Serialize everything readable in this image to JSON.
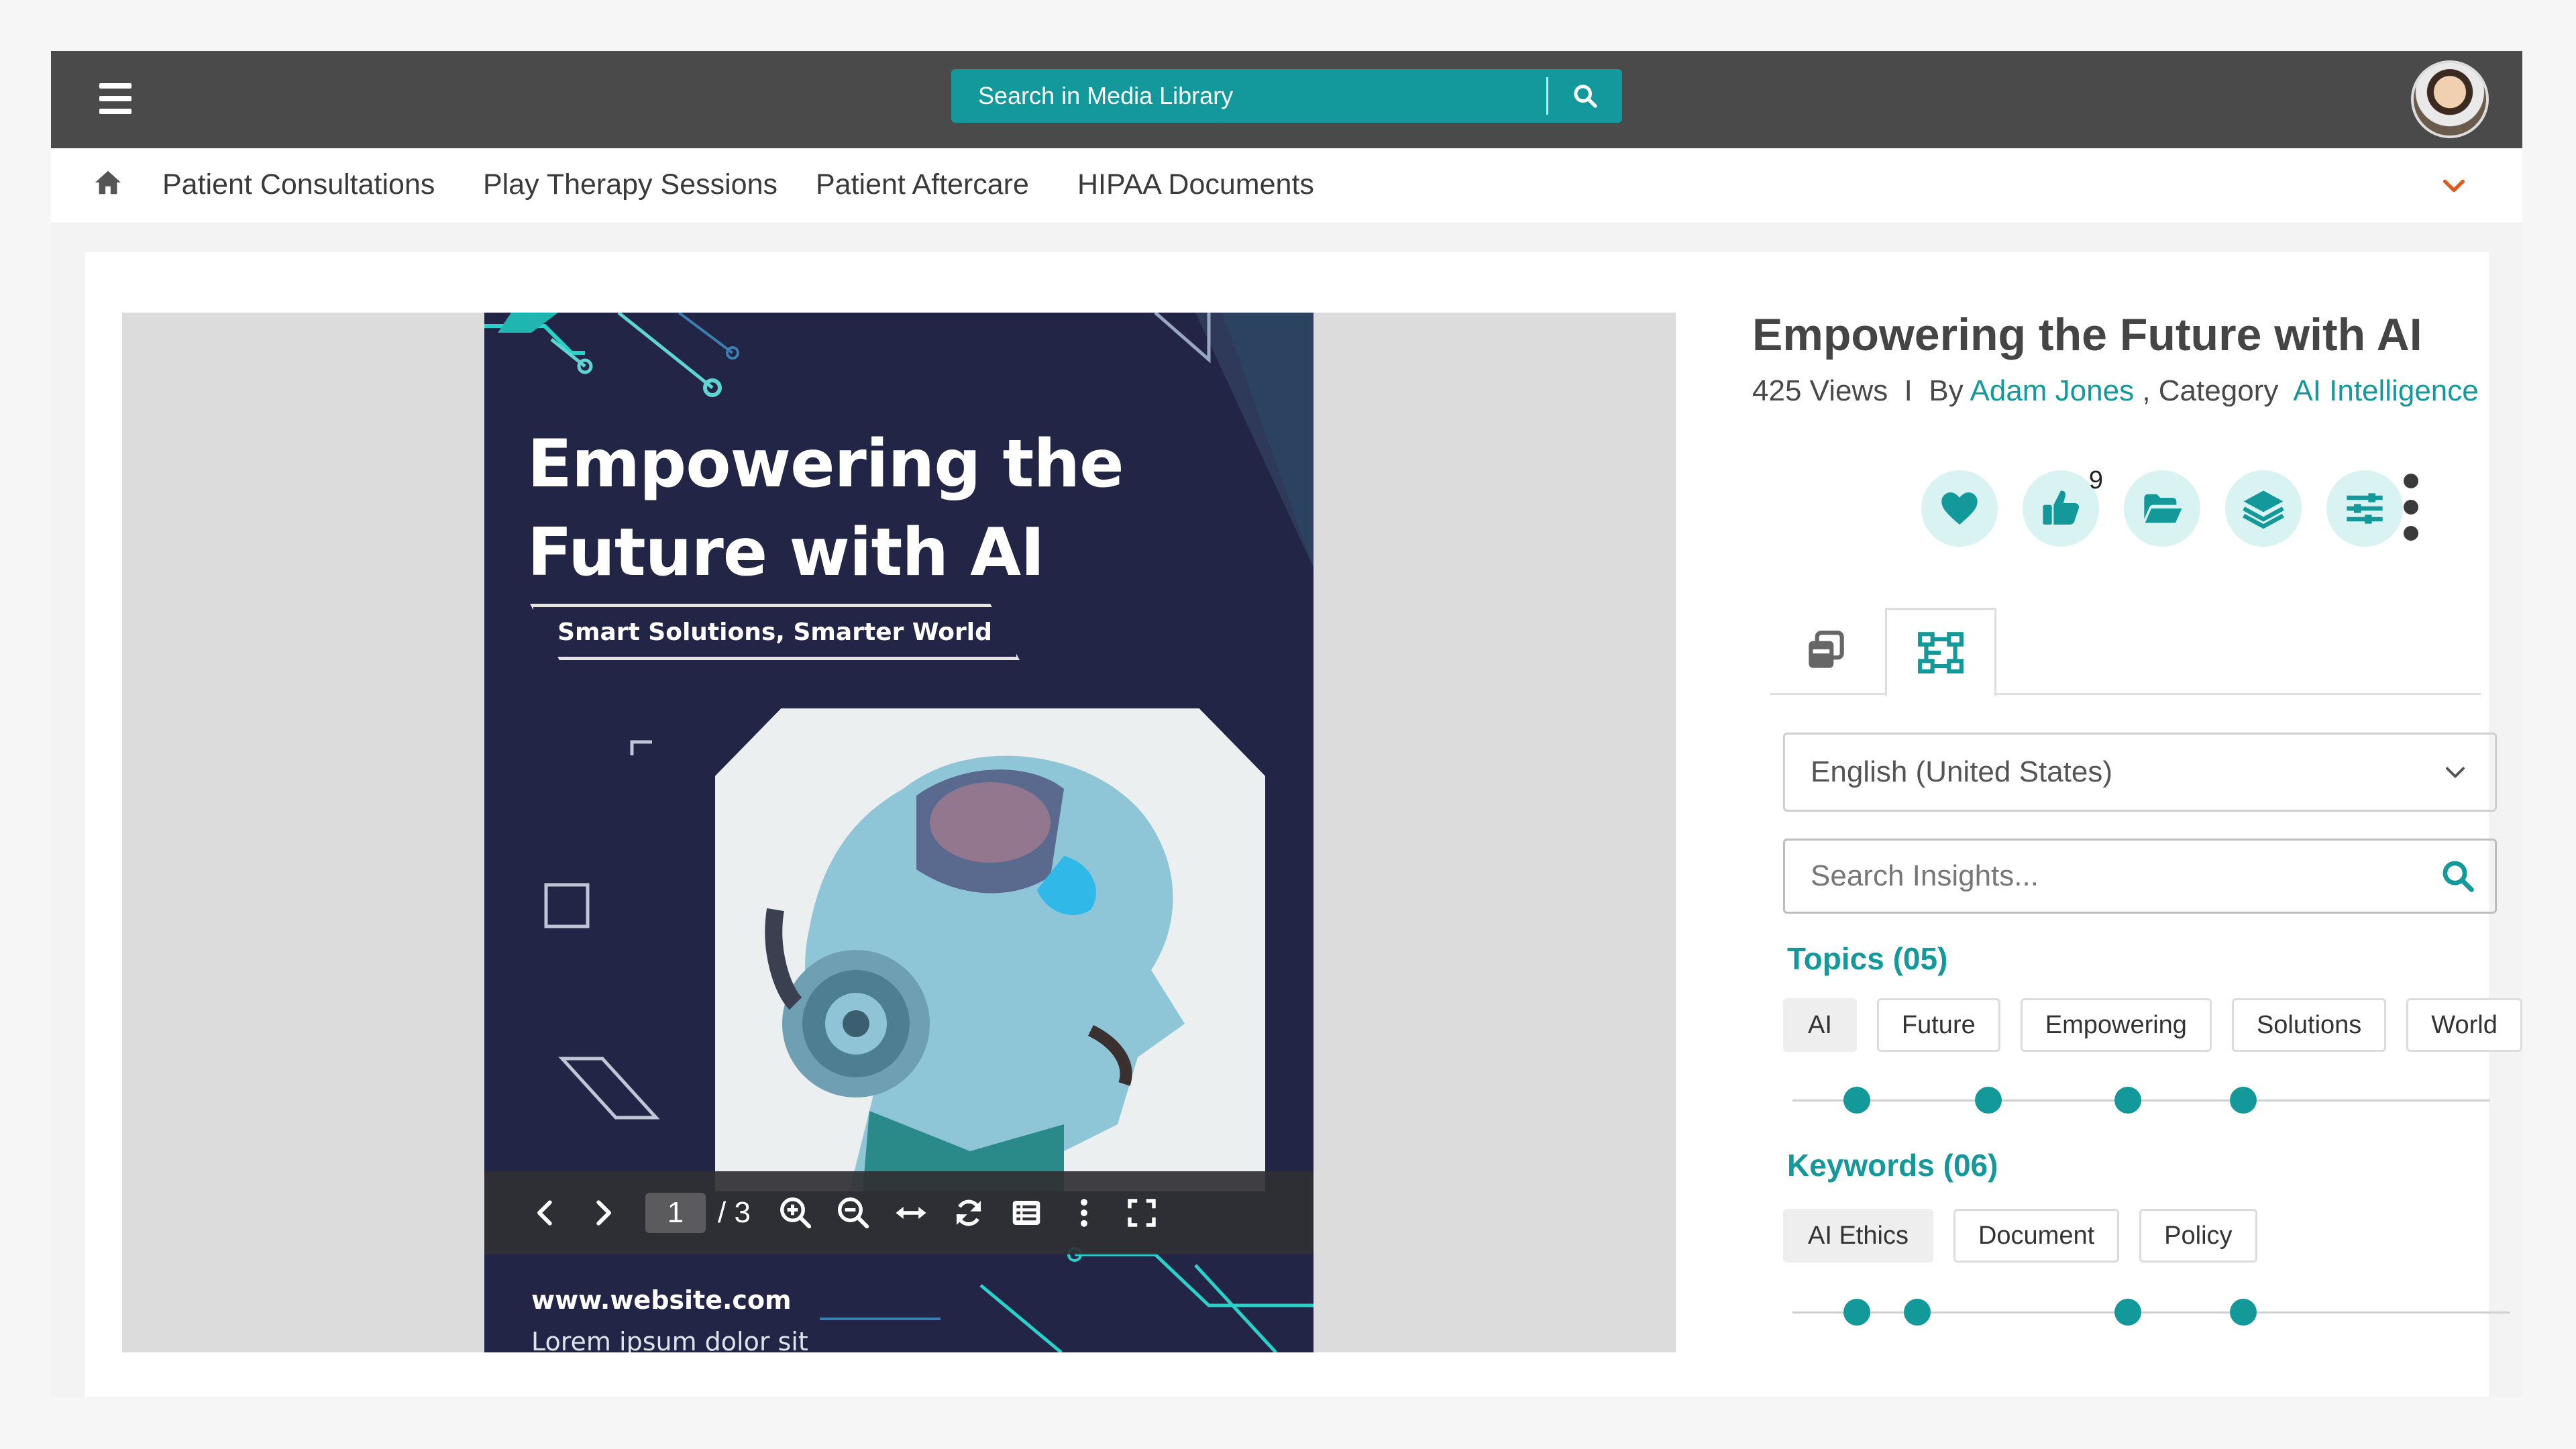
{
  "header": {
    "search_placeholder": "Search in Media Library",
    "menu_icon": "hamburger-menu-icon",
    "search_icon": "search-icon",
    "avatar_icon": "user-avatar",
    "brand_color": "#13999b",
    "bar_color": "#4a4a4a"
  },
  "nav": {
    "home_icon": "home-icon",
    "items": [
      {
        "label": "Patient Consultations"
      },
      {
        "label": "Play Therapy Sessions"
      },
      {
        "label": "Patient Aftercare"
      },
      {
        "label": "HIPAA Documents"
      }
    ],
    "expand_icon": "chevron-down-icon",
    "expand_color": "#e2591c"
  },
  "viewer": {
    "poster": {
      "title": "Empowering the Future with AI",
      "tagline": "Smart Solutions, Smarter World",
      "url": "www.website.com",
      "body": "Lorem ipsum dolor sit"
    },
    "toolbar": {
      "current_page": "1",
      "page_total": "/ 3",
      "icons": [
        "prev-page-icon",
        "next-page-icon",
        "zoom-in-icon",
        "zoom-out-icon",
        "fit-width-icon",
        "rotate-icon",
        "outline-icon",
        "more-options-icon",
        "fullscreen-icon"
      ]
    }
  },
  "details": {
    "title": "Empowering the Future with AI",
    "views": "425 Views",
    "separator": "I",
    "by_label": "By",
    "author": "Adam Jones",
    "category_label": ", Category",
    "category": "AI Intelligence",
    "actions": [
      {
        "icon": "heart-icon"
      },
      {
        "icon": "thumbs-up-icon",
        "count": "9"
      },
      {
        "icon": "folder-open-icon"
      },
      {
        "icon": "layers-icon"
      },
      {
        "icon": "sliders-icon"
      }
    ],
    "kebab_icon": "more-vertical-icon",
    "tabs": [
      {
        "icon": "copies-icon",
        "active": false
      },
      {
        "icon": "workflow-icon",
        "active": true
      }
    ],
    "language": "English (United States)",
    "insights_placeholder": "Search Insights...",
    "topics": {
      "heading": "Topics (05)",
      "items": [
        "AI",
        "Future",
        "Empowering",
        "Solutions",
        "World"
      ],
      "selected": "AI"
    },
    "keywords": {
      "heading": "Keywords (06)",
      "items": [
        "AI Ethics",
        "Document",
        "Policy"
      ],
      "selected": "AI Ethics"
    }
  }
}
